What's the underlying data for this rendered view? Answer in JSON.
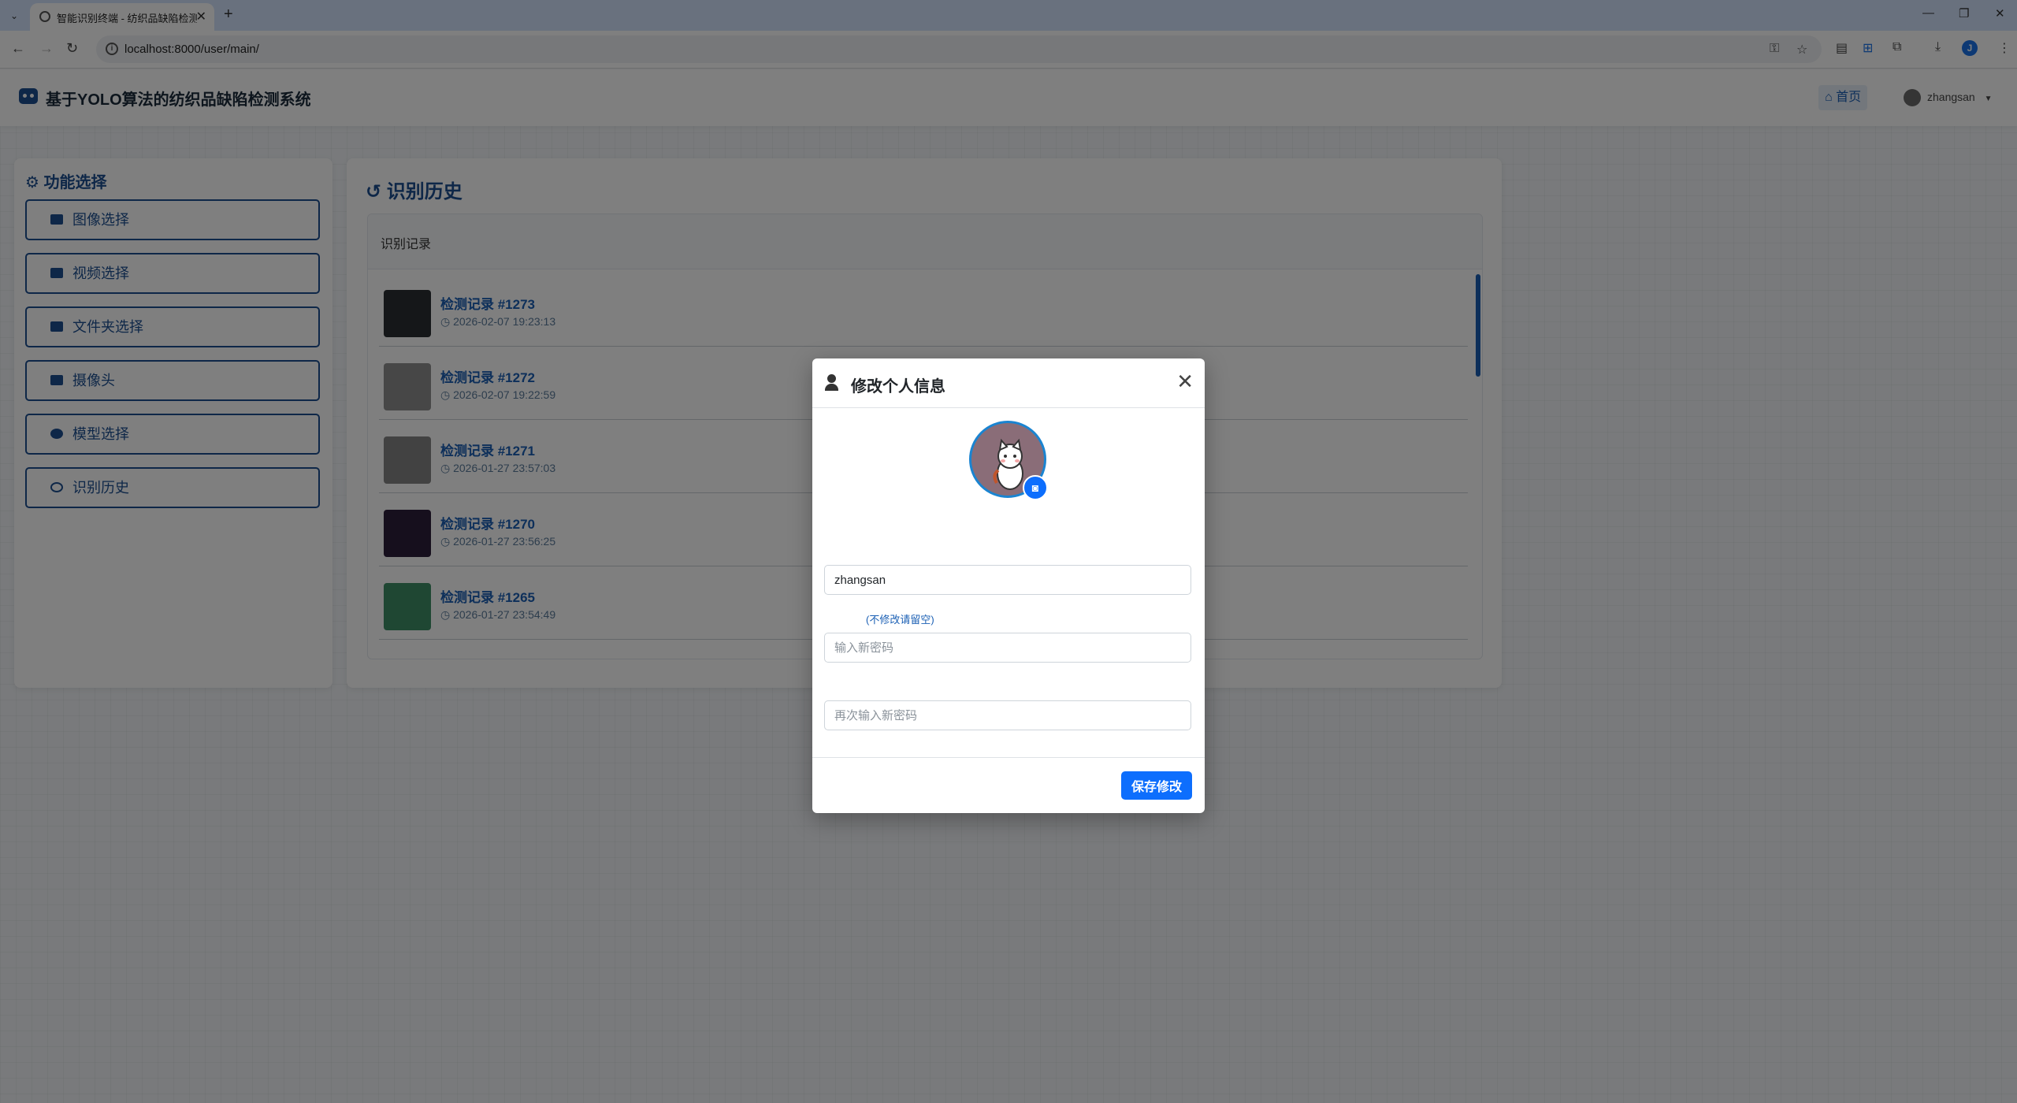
{
  "browser": {
    "tab_title": "智能识别终端 - 纺织品缺陷检测",
    "url": "localhost:8000/user/main/",
    "profile_initial": "J"
  },
  "nav": {
    "brand": "基于YOLO算法的纺织品缺陷检测系统",
    "home_label": "首页",
    "username": "zhangsan"
  },
  "sidebar": {
    "title": "功能选择",
    "items": [
      {
        "label": "图像选择",
        "icon": "image-icon"
      },
      {
        "label": "视频选择",
        "icon": "video-icon"
      },
      {
        "label": "文件夹选择",
        "icon": "folder-icon"
      },
      {
        "label": "摄像头",
        "icon": "camera-icon"
      },
      {
        "label": "模型选择",
        "icon": "brain-icon"
      },
      {
        "label": "识别历史",
        "icon": "history-icon"
      }
    ]
  },
  "history": {
    "title": "识别历史",
    "panel_header": "识别记录",
    "records": [
      {
        "title": "检测记录 #1273",
        "time": "2026-02-07 19:23:13"
      },
      {
        "title": "检测记录 #1272",
        "time": "2026-02-07 19:22:59"
      },
      {
        "title": "检测记录 #1271",
        "time": "2026-01-27 23:57:03"
      },
      {
        "title": "检测记录 #1270",
        "time": "2026-01-27 23:56:25"
      },
      {
        "title": "检测记录 #1265",
        "time": "2026-01-27 23:54:49"
      }
    ]
  },
  "modal": {
    "title": "修改个人信息",
    "username_value": "zhangsan",
    "password_hint": "(不修改请留空)",
    "new_password_placeholder": "输入新密码",
    "confirm_password_placeholder": "再次输入新密码",
    "save_label": "保存修改"
  },
  "colors": {
    "brand": "#1d4f91",
    "primary": "#0d6efd",
    "link": "#1a5fb4"
  }
}
